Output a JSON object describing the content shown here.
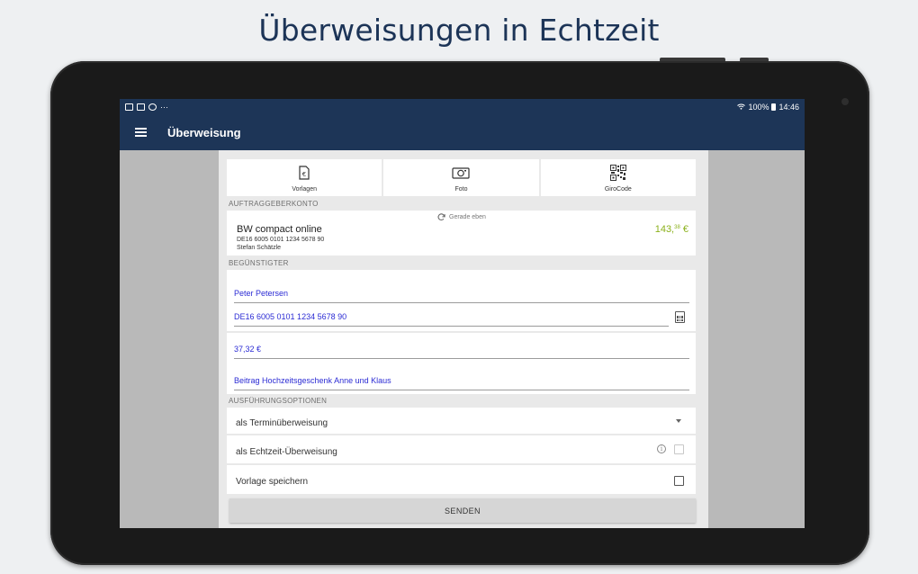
{
  "headline": "Überweisungen in Echtzeit",
  "statusbar": {
    "battery": "100%",
    "time": "14:46",
    "more": "···"
  },
  "appbar": {
    "title": "Überweisung"
  },
  "quick_actions": [
    {
      "label": "Vorlagen",
      "icon": "template-euro-icon"
    },
    {
      "label": "Foto",
      "icon": "camera-icon"
    },
    {
      "label": "GiroCode",
      "icon": "qr-code-icon"
    }
  ],
  "sections": {
    "sender": "AUFTRAGGEBERKONTO",
    "beneficiary": "BEGÜNSTIGTER",
    "options": "AUSFÜHRUNGSOPTIONEN"
  },
  "account": {
    "refresh": "Gerade eben",
    "name": "BW compact online",
    "iban": "DE16 6005 0101 1234 5678 90",
    "holder": "Stefan Schätzle",
    "balance_main": "143,",
    "balance_cents": "38",
    "balance_currency": " €",
    "balance_color": "#8bb11b"
  },
  "beneficiary": {
    "name": "Peter Petersen",
    "iban": "DE16 6005 0101 1234 5678 90",
    "amount": "37,32 €",
    "purpose": "Beitrag Hochzeitsgeschenk Anne und Klaus"
  },
  "options": {
    "schedule": "als Terminüberweisung",
    "instant": "als Echtzeit-Überweisung",
    "save_template": "Vorlage speichern",
    "instant_checked": false,
    "save_template_checked": false
  },
  "send_label": "SENDEN",
  "colors": {
    "brand": "#1d3557",
    "input_text": "#2b2bd4"
  }
}
